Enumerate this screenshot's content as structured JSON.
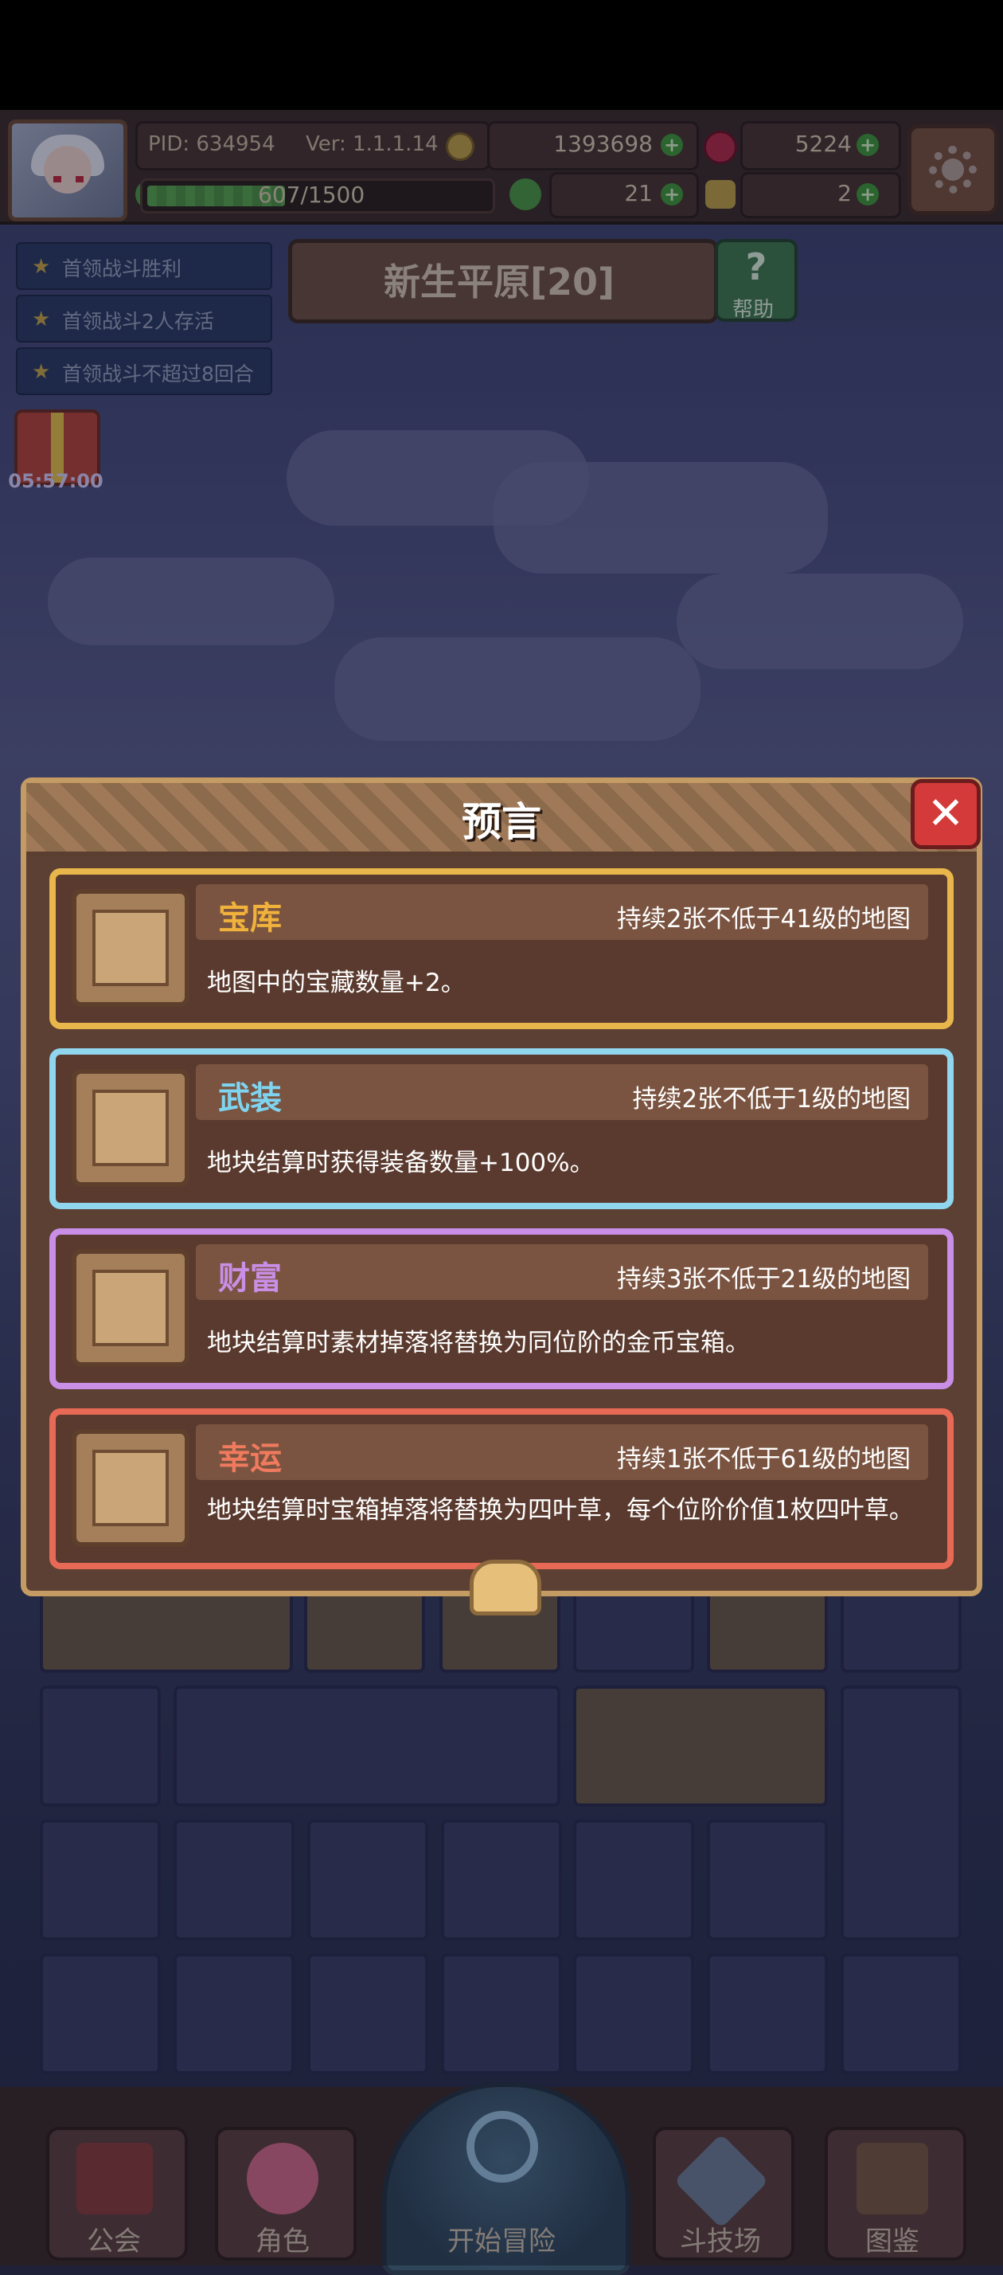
{
  "hud": {
    "pid": "PID: 634954",
    "version": "Ver: 1.1.1.14",
    "gold": "1393698",
    "gems": "5224",
    "xp_text": "607/1500",
    "xp_fraction": 0.405,
    "clover": "21",
    "key": "2"
  },
  "quests": [
    {
      "label": "首领战斗胜利"
    },
    {
      "label": "首领战斗2人存活"
    },
    {
      "label": "首领战斗不超过8回合"
    }
  ],
  "map": {
    "title": "新生平原[20]",
    "help_label": "帮助"
  },
  "gift": {
    "timer": "05:57:00"
  },
  "dialog": {
    "title": "预言",
    "cards": [
      {
        "name": "宝库",
        "condition": "持续2张不低于41级的地图",
        "desc": "地图中的宝藏数量+2。",
        "color": "#f0b23c",
        "icon": "scroll-icon"
      },
      {
        "name": "武装",
        "condition": "持续2张不低于1级的地图",
        "desc": "地块结算时获得装备数量+100%。",
        "color": "#7fd4f0",
        "icon": "scroll-icon"
      },
      {
        "name": "财富",
        "condition": "持续3张不低于21级的地图",
        "desc": "地块结算时素材掉落将替换为同位阶的金币宝箱。",
        "color": "#c98ee6",
        "icon": "coin-stack-icon"
      },
      {
        "name": "幸运",
        "condition": "持续1张不低于61级的地图",
        "desc": "地块结算时宝箱掉落将替换为四叶草，每个位阶价值1枚四叶草。",
        "color": "#f07a5e",
        "icon": "clover-icon"
      }
    ]
  },
  "nav": {
    "guild": "公会",
    "role": "角色",
    "start": "开始冒险",
    "arena": "斗技场",
    "codex": "图鉴"
  }
}
